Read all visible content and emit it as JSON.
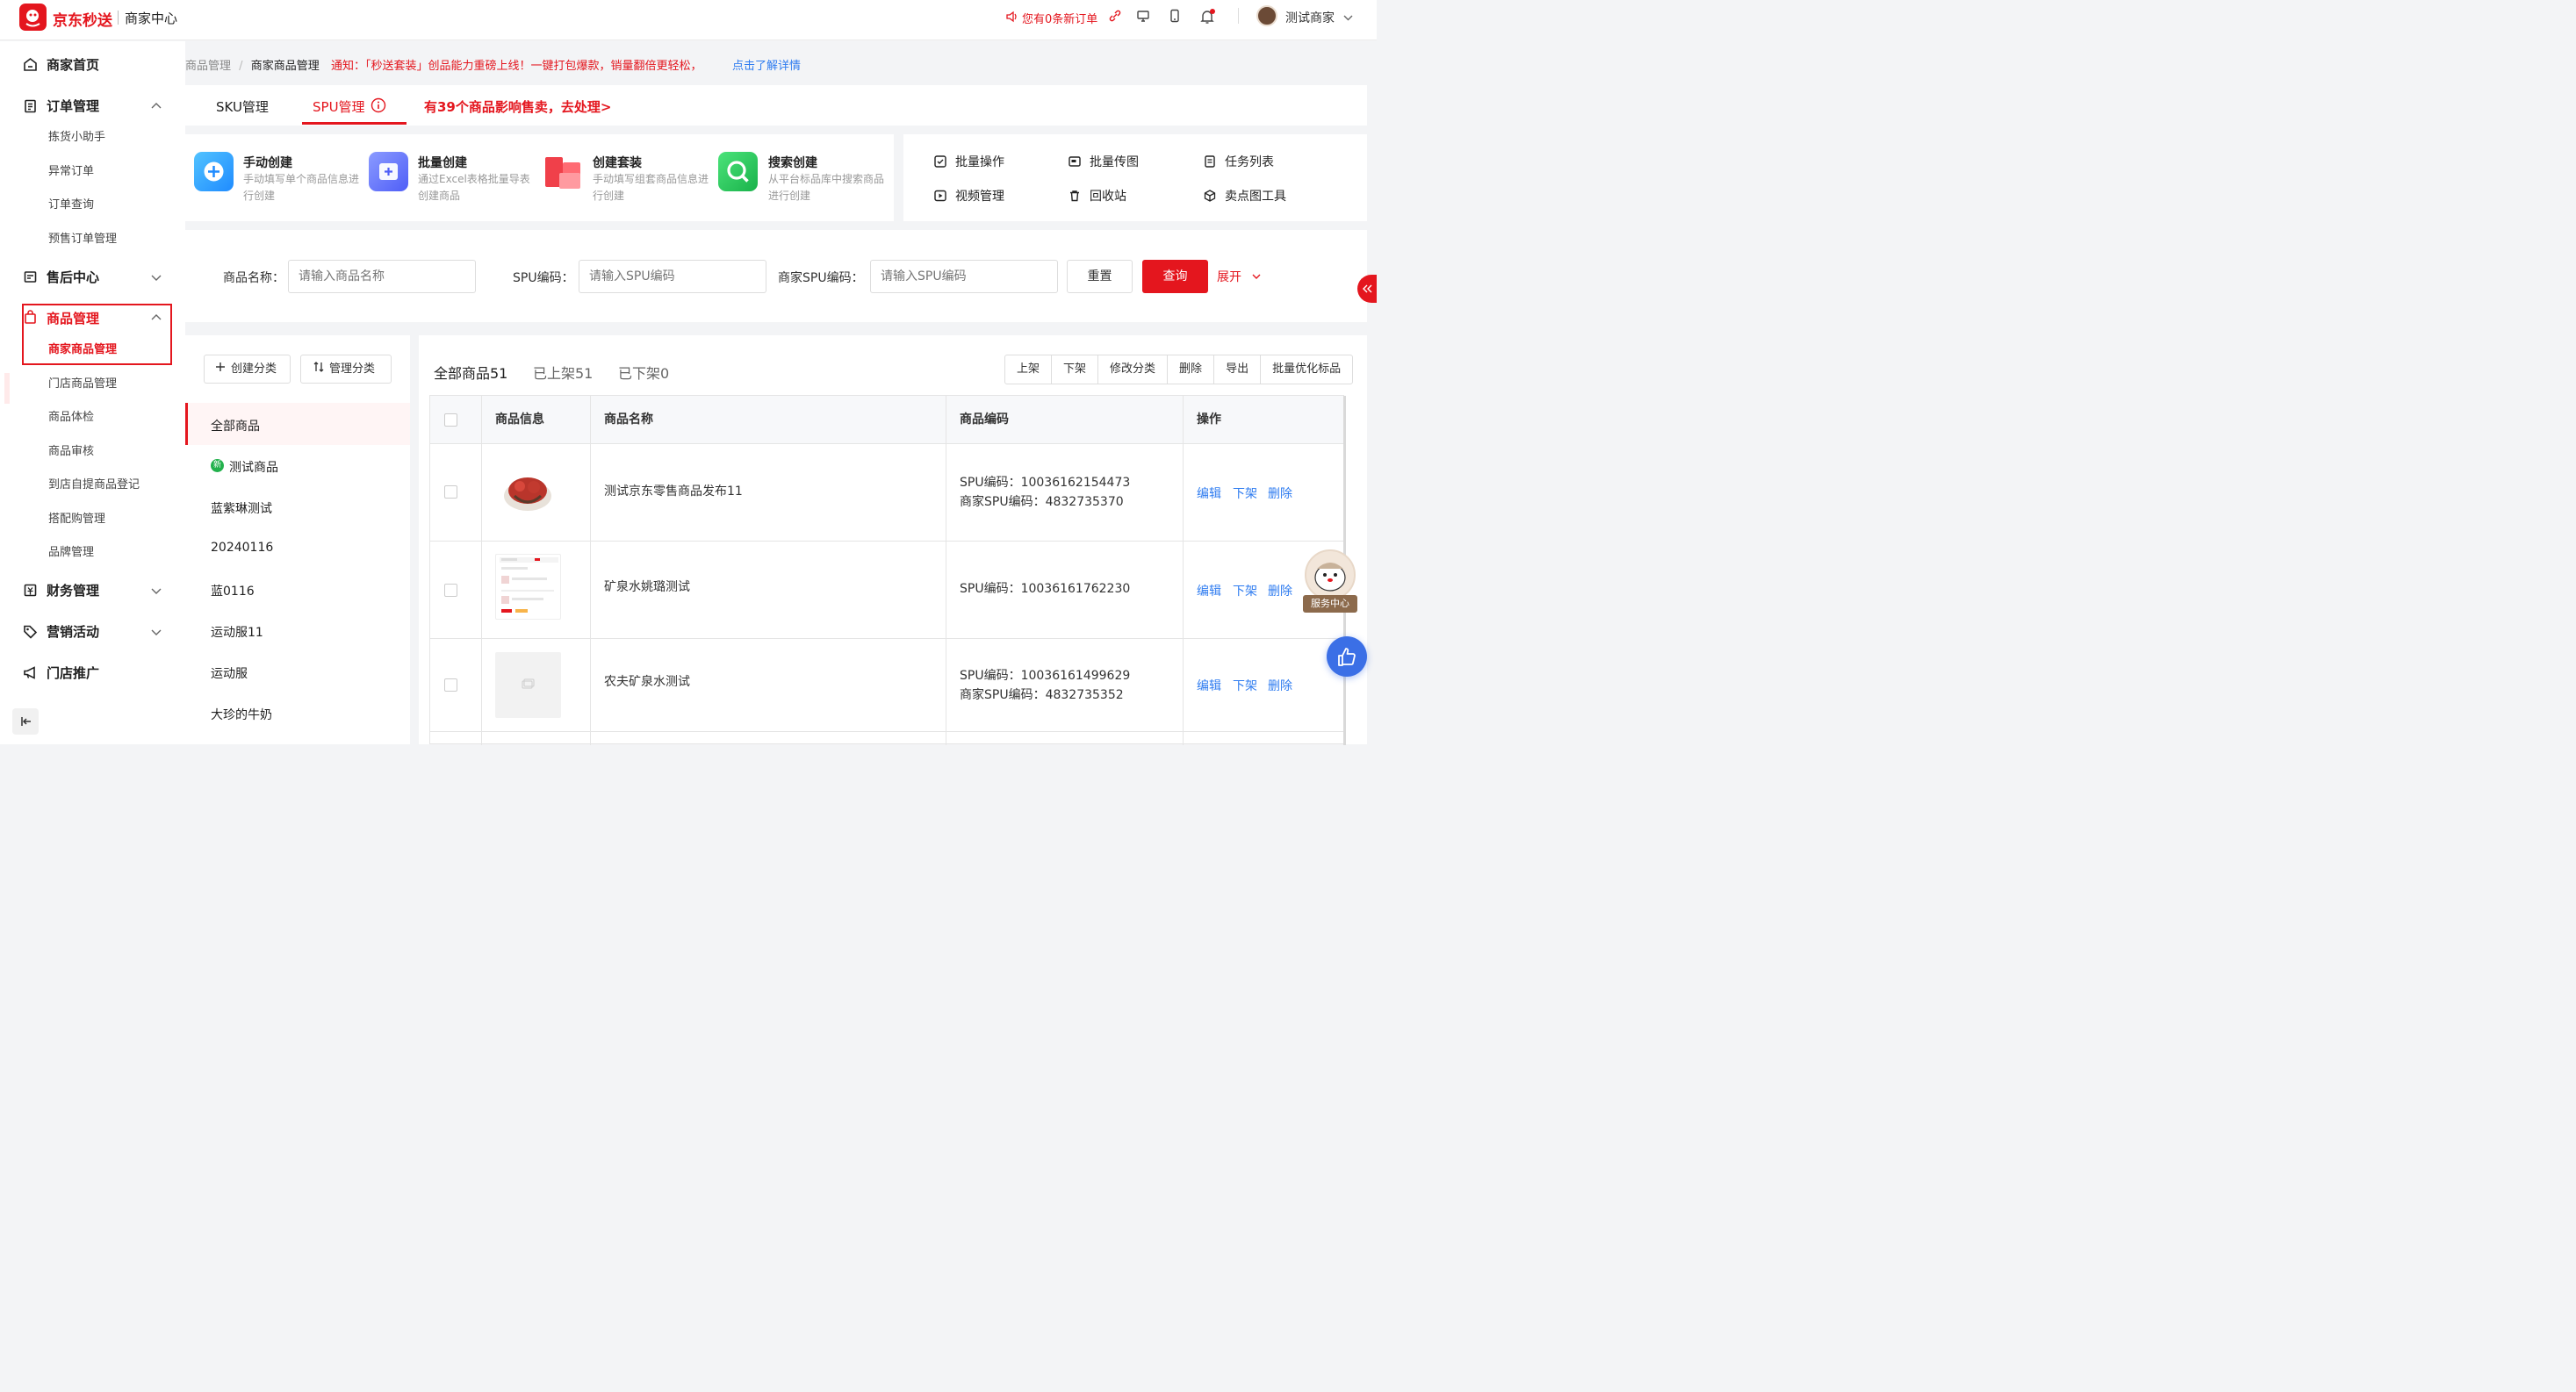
{
  "header": {
    "brand": "京东秒送",
    "sub_brand": "商家中心",
    "order_notice": "您有0条新订单",
    "user_name": "测试商家"
  },
  "sidebar": {
    "items": [
      {
        "label": "商家首页",
        "icon": "home-icon"
      },
      {
        "label": "订单管理",
        "icon": "clipboard-icon",
        "expanded": true,
        "children": [
          "拣货小助手",
          "异常订单",
          "订单查询",
          "预售订单管理"
        ]
      },
      {
        "label": "售后中心",
        "icon": "aftersale-icon",
        "expanded": false
      },
      {
        "label": "商品管理",
        "icon": "bag-icon",
        "expanded": true,
        "active": true,
        "children": [
          "商家商品管理",
          "门店商品管理",
          "商品体检",
          "商品审核",
          "到店自提商品登记",
          "搭配购管理",
          "品牌管理"
        ]
      },
      {
        "label": "财务管理",
        "icon": "finance-icon",
        "expanded": false
      },
      {
        "label": "营销活动",
        "icon": "tag-icon",
        "expanded": false
      },
      {
        "label": "门店推广",
        "icon": "megaphone-icon"
      }
    ]
  },
  "breadcrumb": {
    "level1": "商品管理",
    "sep": "/",
    "level2": "商家商品管理"
  },
  "notice": {
    "text": "通知：「秒送套装」创品能力重磅上线！一键打包爆款，销量翻倍更轻松，",
    "link": "点击了解详情"
  },
  "tabs": {
    "sku": "SKU管理",
    "spu": "SPU管理",
    "warning": "有39个商品影响售卖，去处理>"
  },
  "create_cards": [
    {
      "title": "手动创建",
      "desc": "手动填写单个商品信息进行创建",
      "color": "#2fa4ff"
    },
    {
      "title": "批量创建",
      "desc": "通过Excel表格批量导表创建商品",
      "color": "#5b6cff"
    },
    {
      "title": "创建套装",
      "desc": "手动填写组套商品信息进行创建",
      "color": "#f0404a"
    },
    {
      "title": "搜索创建",
      "desc": "从平台标品库中搜索商品进行创建",
      "color": "#2dc65a"
    }
  ],
  "ops": {
    "batch_op": "批量操作",
    "batch_img": "批量传图",
    "task_list": "任务列表",
    "video": "视频管理",
    "recycle": "回收站",
    "selling_img": "卖点图工具"
  },
  "search": {
    "name_label": "商品名称：",
    "name_placeholder": "请输入商品名称",
    "spu_label": "SPU编码：",
    "spu_placeholder": "请输入SPU编码",
    "merchant_spu_label": "商家SPU编码：",
    "merchant_spu_placeholder": "请输入SPU编码",
    "reset": "重置",
    "query": "查询",
    "expand": "展开"
  },
  "categories": {
    "create_btn": "创建分类",
    "manage_btn": "管理分类",
    "new_badge": "新",
    "items": [
      "全部商品",
      "测试商品",
      "蓝紫琳测试",
      "20240116",
      "蓝0116",
      "运动服11",
      "运动服",
      "大珍的牛奶"
    ]
  },
  "filter_tabs": {
    "all": "全部商品51",
    "on": "已上架51",
    "off": "已下架0"
  },
  "bulk_actions": [
    "上架",
    "下架",
    "修改分类",
    "删除",
    "导出",
    "批量优化标品"
  ],
  "table": {
    "headers": {
      "info": "商品信息",
      "name": "商品名称",
      "code": "商品编码",
      "ops": "操作"
    },
    "rows": [
      {
        "name": "测试京东零售商品发布11",
        "spu": "SPU编码：10036162154473",
        "merchant_spu": "商家SPU编码：4832735370"
      },
      {
        "name": "矿泉水姚璐测试",
        "spu": "SPU编码：10036161762230",
        "merchant_spu": ""
      },
      {
        "name": "农夫矿泉水测试",
        "spu": "SPU编码：10036161499629",
        "merchant_spu": "商家SPU编码：4832735352"
      }
    ],
    "actions": {
      "edit": "编辑",
      "offshelf": "下架",
      "delete": "删除"
    }
  },
  "float": {
    "service": "服务中心"
  },
  "colors": {
    "brand_red": "#e4161e",
    "link_blue": "#2f7cf0"
  }
}
